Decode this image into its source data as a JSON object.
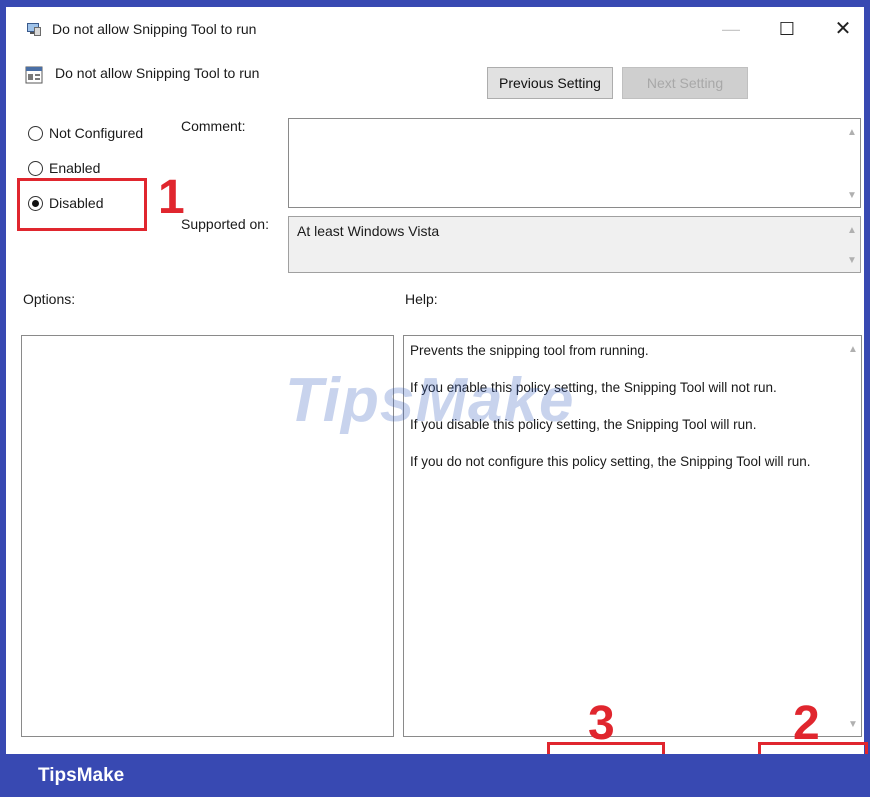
{
  "window": {
    "title": "Do not allow Snipping Tool to run",
    "controls": {
      "minimize": "—",
      "maximize": "☐",
      "close": "✕"
    }
  },
  "policy": {
    "name": "Do not allow Snipping Tool to run",
    "prev_label": "Previous Setting",
    "next_label": "Next Setting"
  },
  "state": {
    "options": [
      {
        "label": "Not Configured",
        "checked": false
      },
      {
        "label": "Enabled",
        "checked": false
      },
      {
        "label": "Disabled",
        "checked": true
      }
    ]
  },
  "fields": {
    "comment_label": "Comment:",
    "comment_value": "",
    "supported_label": "Supported on:",
    "supported_value": "At least Windows Vista"
  },
  "sections": {
    "options_label": "Options:",
    "help_label": "Help:"
  },
  "help": {
    "paragraphs": [
      "Prevents the snipping tool from running.",
      "If you enable this policy setting, the Snipping Tool will not run.",
      "If you disable this policy setting, the Snipping Tool will run.",
      "If you do not configure this policy setting, the Snipping Tool will run."
    ]
  },
  "annotations": {
    "step1": "1",
    "step2": "2",
    "step3": "3",
    "accent_color": "#e0262e"
  },
  "watermark": "TipsMake",
  "footer": {
    "brand": "TipsMake",
    "bar_color": "#3849b2"
  }
}
